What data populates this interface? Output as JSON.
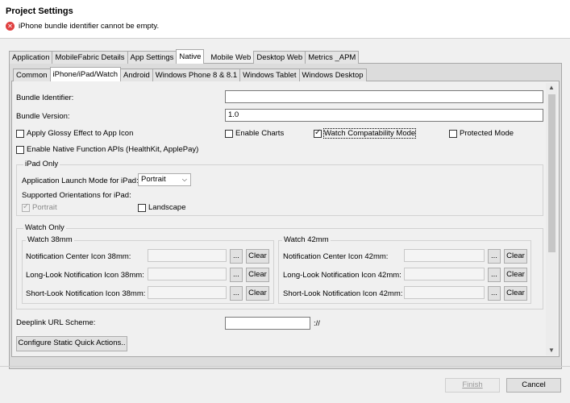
{
  "dialog": {
    "title": "Project Settings",
    "error_message": "iPhone bundle identifier cannot be empty."
  },
  "top_tabs": [
    "Application",
    "MobileFabric Details",
    "App Settings",
    "Native",
    "Mobile Web",
    "Desktop Web",
    "Metrics _APM"
  ],
  "sub_tabs": [
    "Common",
    "iPhone/iPad/Watch",
    "Android",
    "Windows Phone 8 & 8.1",
    "Windows Tablet",
    "Windows Desktop"
  ],
  "form": {
    "bundle_identifier_label": "Bundle Identifier:",
    "bundle_identifier_value": "",
    "bundle_version_label": "Bundle Version:",
    "bundle_version_value": "1.0",
    "apply_glossy_label": "Apply Glossy Effect to App Icon",
    "enable_charts_label": "Enable Charts",
    "watch_compat_label": "Watch Compatability Mode",
    "protected_mode_label": "Protected Mode",
    "native_apis_label": "Enable Native Function APIs (HealthKit, ApplePay)"
  },
  "ipad": {
    "group_title": "iPad Only",
    "launch_mode_label": "Application Launch Mode for iPad:",
    "launch_mode_value": "Portrait",
    "orientations_label": "Supported Orientations for iPad:",
    "portrait_label": "Portrait",
    "landscape_label": "Landscape"
  },
  "watch": {
    "group_title": "Watch Only",
    "w38": {
      "title": "Watch 38mm",
      "notif_label": "Notification Center Icon 38mm:",
      "long_label": "Long-Look Notification Icon 38mm:",
      "short_label": "Short-Look Notification Icon 38mm:"
    },
    "w42": {
      "title": "Watch 42mm",
      "notif_label": "Notification Center Icon 42mm:",
      "long_label": "Long-Look Notification Icon 42mm:",
      "short_label": "Short-Look Notification Icon 42mm:"
    },
    "browse_label": "...",
    "clear_label": "Clear"
  },
  "deeplink": {
    "label": "Deeplink URL Scheme:",
    "value": "",
    "suffix": "://"
  },
  "quick_actions_label": "Configure Static Quick Actions..",
  "footer": {
    "finish_label": "Finish",
    "cancel_label": "Cancel"
  }
}
